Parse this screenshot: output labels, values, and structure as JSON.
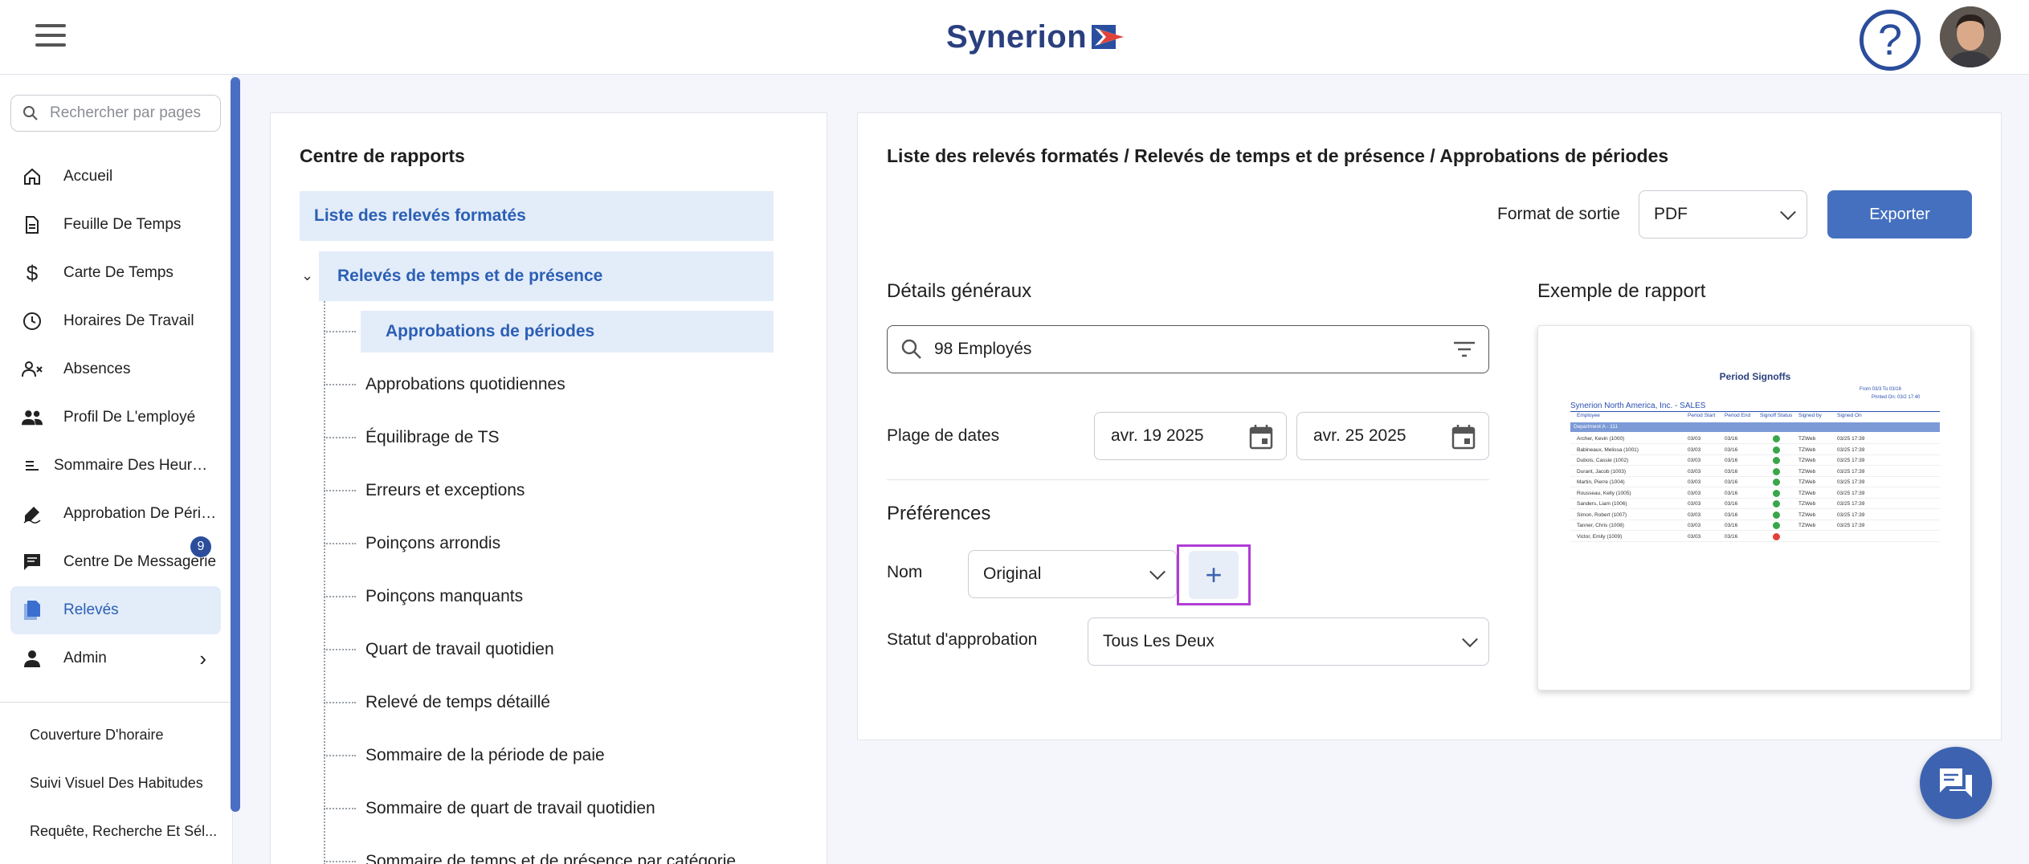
{
  "header": {
    "logo_text": "Synerion",
    "help_label": "?"
  },
  "sidebar": {
    "search_placeholder": "Rechercher par pages",
    "items": [
      {
        "label": "Accueil",
        "icon": "home-icon"
      },
      {
        "label": "Feuille De Temps",
        "icon": "document-icon"
      },
      {
        "label": "Carte De Temps",
        "icon": "dollar-icon"
      },
      {
        "label": "Horaires De Travail",
        "icon": "clock-icon"
      },
      {
        "label": "Absences",
        "icon": "person-x-icon"
      },
      {
        "label": "Profil De L'employé",
        "icon": "people-icon"
      },
      {
        "label": "Sommaire Des Heures ...",
        "icon": "list-icon"
      },
      {
        "label": "Approbation De Périod...",
        "icon": "sign-icon"
      },
      {
        "label": "Centre De Messagerie",
        "icon": "message-icon"
      },
      {
        "label": "Relevés",
        "icon": "reports-icon"
      },
      {
        "label": "Admin",
        "icon": "person-icon"
      }
    ],
    "message_badge": "9",
    "sub_items": [
      {
        "label": "Couverture D'horaire"
      },
      {
        "label": "Suivi Visuel Des Habitudes"
      },
      {
        "label": "Requête, Recherche Et Sél..."
      }
    ]
  },
  "report_center": {
    "title": "Centre de rapports",
    "root": "Liste des relevés formatés",
    "group": "Relevés de temps et de présence",
    "leaves": [
      "Approbations de périodes",
      "Approbations quotidiennes",
      "Équilibrage de TS",
      "Erreurs et exceptions",
      "Poinçons arrondis",
      "Poinçons manquants",
      "Quart de travail quotidien",
      "Relevé de temps détaillé",
      "Sommaire de la période de paie",
      "Sommaire de quart de travail quotidien",
      "Sommaire de temps et de présence par catégorie"
    ]
  },
  "detail": {
    "breadcrumb": "Liste des relevés formatés / Relevés de temps et de présence / Approbations de périodes",
    "output_format_label": "Format de sortie",
    "output_format_value": "PDF",
    "export_label": "Exporter",
    "general_details": "Détails généraux",
    "employees_value": "98 Employés",
    "date_range_label": "Plage de dates",
    "date_from": "avr. 19 2025",
    "date_to": "avr. 25 2025",
    "preferences": "Préférences",
    "name_label": "Nom",
    "name_value": "Original",
    "add_label": "+",
    "approval_status_label": "Statut d'approbation",
    "approval_status_value": "Tous Les Deux",
    "sample_title": "Exemple de rapport"
  },
  "preview": {
    "title": "Period Signoffs",
    "from_to": "From 03/3 To 03/16",
    "printed_on": "Printed On: 03/2 17:40",
    "company": "Synerion North America, Inc. - SALES",
    "columns": [
      "Employee",
      "Period Start",
      "Period End",
      "Signoff Status",
      "Signed by",
      "Signed On"
    ],
    "department": "Department A - 111",
    "rows": [
      {
        "name": "Archer, Kevin (1000)",
        "start": "03/03",
        "end": "03/16",
        "status": "ok",
        "by": "TZWeb",
        "on": "03/25 17:39"
      },
      {
        "name": "Babineaux, Melissa (1001)",
        "start": "03/03",
        "end": "03/16",
        "status": "ok",
        "by": "TZWeb",
        "on": "03/25 17:39"
      },
      {
        "name": "Dubois, Cassie (1002)",
        "start": "03/03",
        "end": "03/16",
        "status": "ok",
        "by": "TZWeb",
        "on": "03/25 17:39"
      },
      {
        "name": "Durant, Jacob (1003)",
        "start": "03/03",
        "end": "03/16",
        "status": "ok",
        "by": "TZWeb",
        "on": "03/25 17:39"
      },
      {
        "name": "Martin, Pierre (1004)",
        "start": "03/03",
        "end": "03/16",
        "status": "ok",
        "by": "TZWeb",
        "on": "03/25 17:39"
      },
      {
        "name": "Rousseau, Kelly (1005)",
        "start": "03/03",
        "end": "03/16",
        "status": "ok",
        "by": "TZWeb",
        "on": "03/25 17:39"
      },
      {
        "name": "Sanders, Liam (1006)",
        "start": "03/03",
        "end": "03/16",
        "status": "ok",
        "by": "TZWeb",
        "on": "03/25 17:39"
      },
      {
        "name": "Simon, Robert (1007)",
        "start": "03/03",
        "end": "03/16",
        "status": "ok",
        "by": "TZWeb",
        "on": "03/25 17:39"
      },
      {
        "name": "Tanner, Chris (1008)",
        "start": "03/03",
        "end": "03/16",
        "status": "ok",
        "by": "TZWeb",
        "on": "03/25 17:39"
      },
      {
        "name": "Victor, Emily (1009)",
        "start": "03/03",
        "end": "03/16",
        "status": "bad",
        "by": "",
        "on": ""
      }
    ]
  },
  "colors": {
    "brand": "#2a3f7e",
    "accent": "#4470bf",
    "active_bg": "#e3ecf9",
    "highlight": "#b03cd6"
  }
}
